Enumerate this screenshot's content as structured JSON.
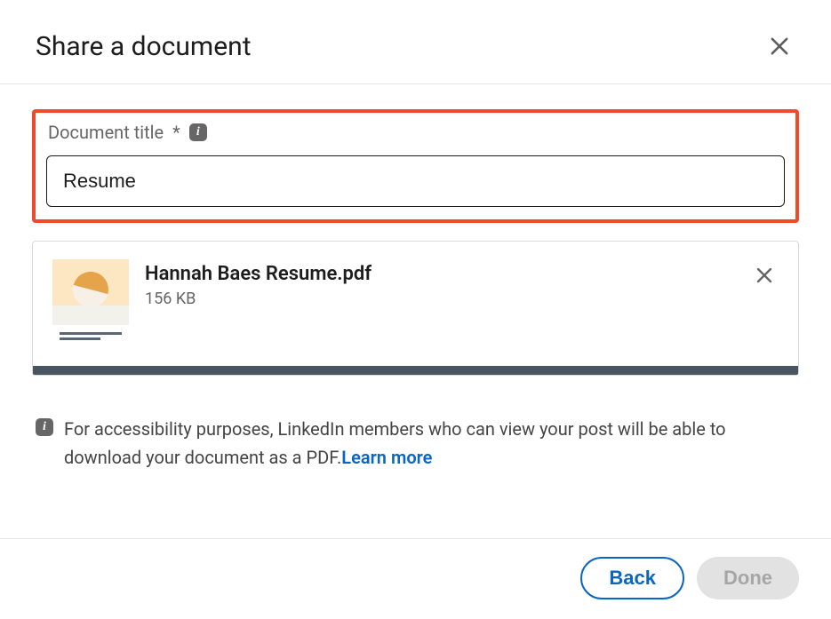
{
  "header": {
    "title": "Share a document"
  },
  "titleField": {
    "label": "Document title",
    "required_mark": "*",
    "value": "Resume"
  },
  "file": {
    "name": "Hannah Baes Resume.pdf",
    "size": "156 KB",
    "progress_percent": 100
  },
  "note": {
    "text": "For accessibility purposes, LinkedIn members who can view your post will be able to download your document as a PDF.",
    "learn_more": "Learn more"
  },
  "footer": {
    "back_label": "Back",
    "done_label": "Done"
  },
  "icons": {
    "close": "close-icon",
    "info": "info-icon",
    "file_remove": "remove-file-icon",
    "document_thumb": "document-thumb-icon"
  }
}
